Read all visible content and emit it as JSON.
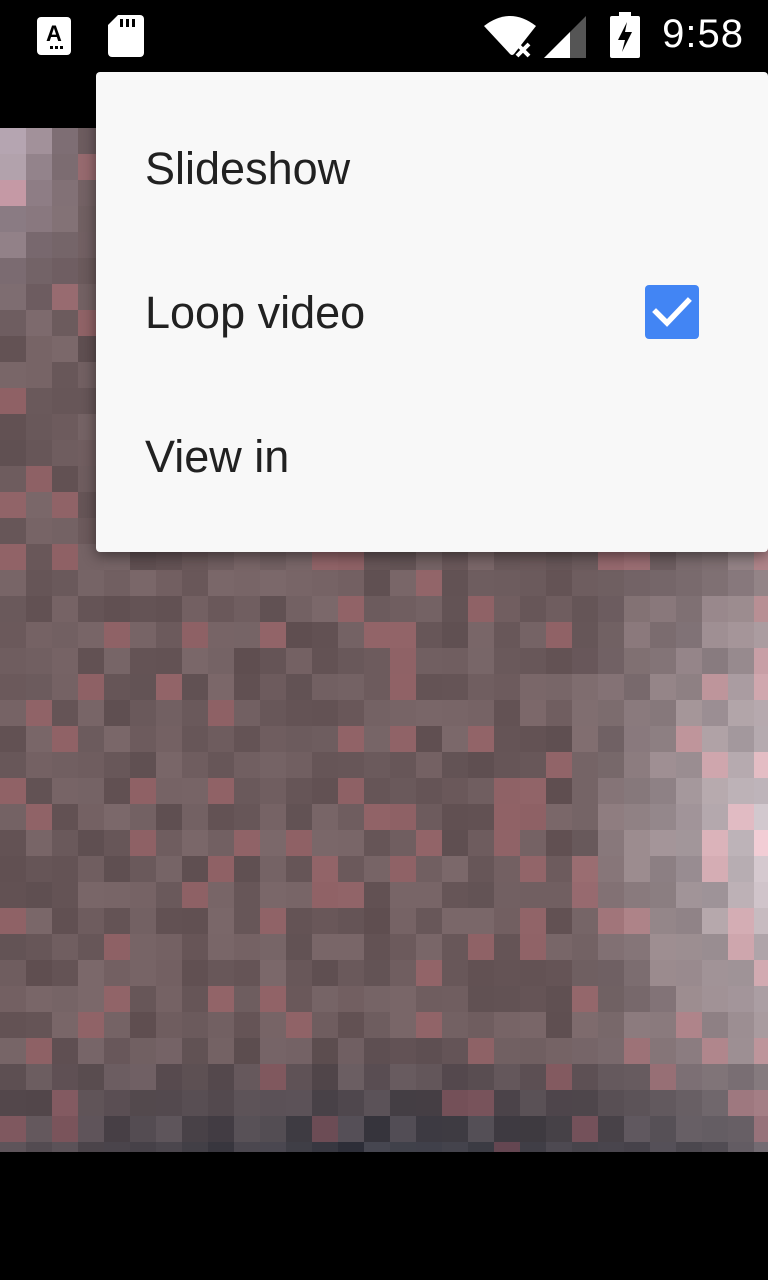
{
  "status_bar": {
    "time": "9:58",
    "icons": [
      "keyboard-a-icon",
      "sd-card-icon",
      "wifi-no-internet-icon",
      "cell-signal-icon",
      "battery-charging-icon"
    ]
  },
  "menu": {
    "items": [
      {
        "label": "Slideshow"
      },
      {
        "label": "Loop video",
        "checked": true
      },
      {
        "label": "View in"
      }
    ]
  },
  "colors": {
    "menu_bg": "#f8f8f8",
    "checkbox": "#4285f4",
    "text": "#212121"
  }
}
